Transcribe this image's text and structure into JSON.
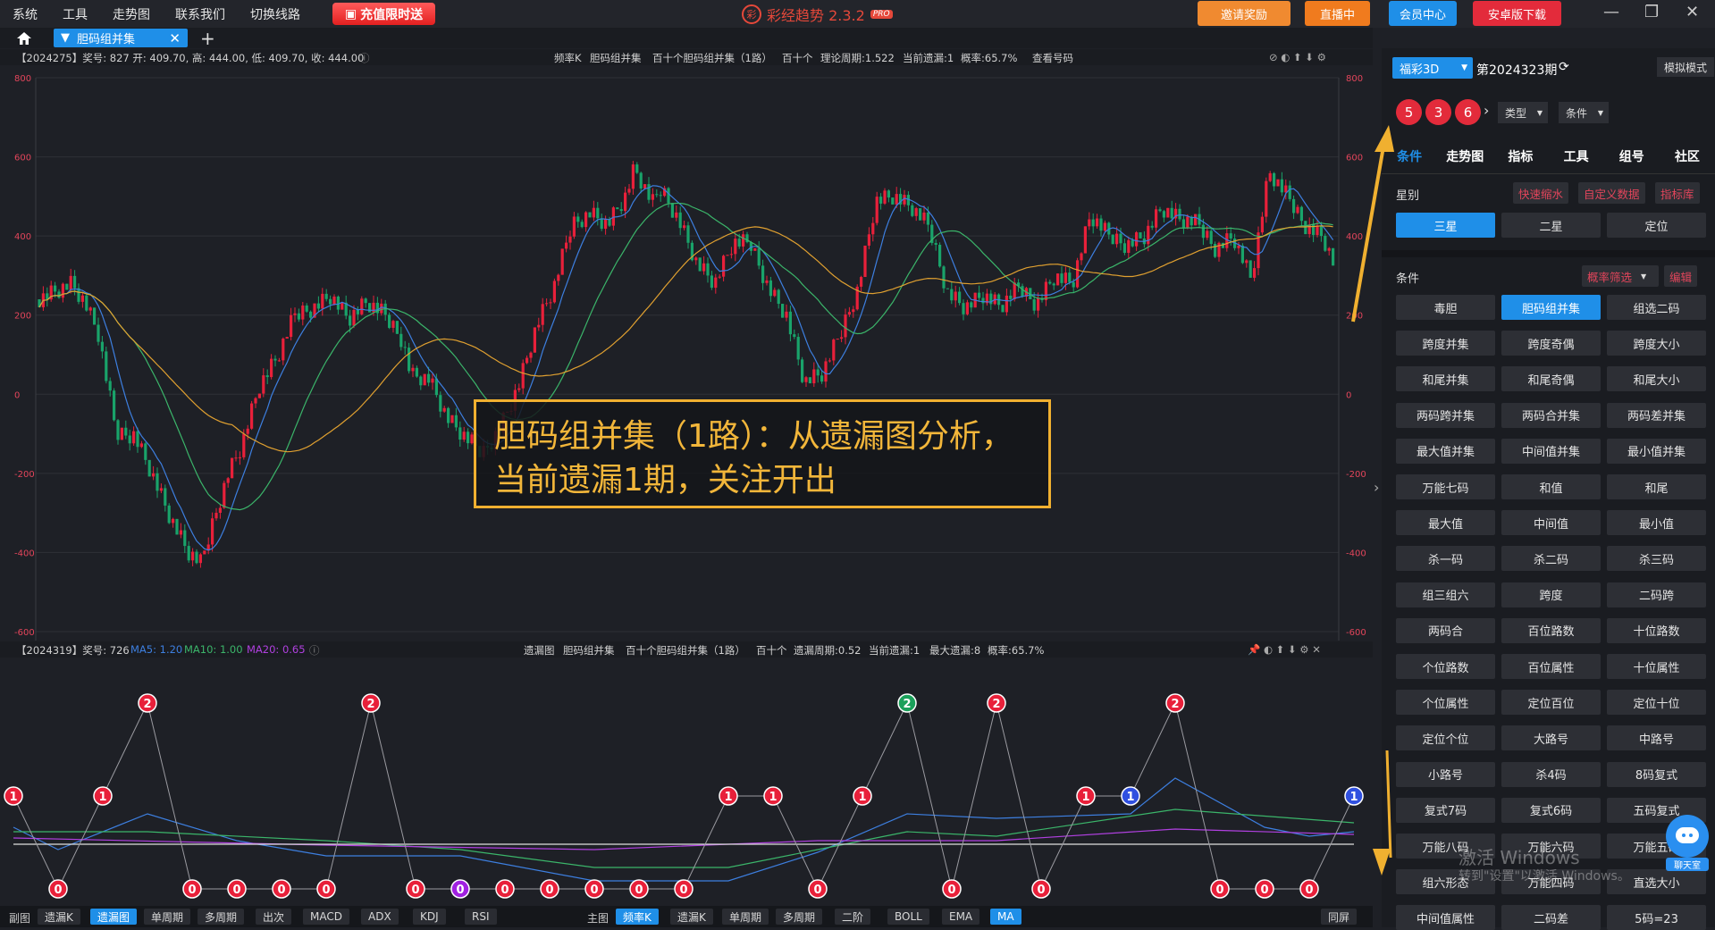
{
  "menu": [
    "系统",
    "工具",
    "走势图",
    "联系我们",
    "切换线路"
  ],
  "promo_label": "充值限时送",
  "app": {
    "name": "彩经趋势 2.3.2",
    "badge": "PRO"
  },
  "top_buttons": {
    "invite": "邀请奖励",
    "live": "直播中",
    "member": "会员中心",
    "android": "安卓版下载"
  },
  "tab": {
    "label": "胆码组并集"
  },
  "chart1": {
    "info_left": "【2024275】奖号: 827  开: 409.70, 高: 444.00, 低: 409.70, 收: 444.00",
    "info_mid": [
      "频率K",
      "胆码组并集",
      "百十个胆码组并集（1路）",
      "百十个",
      "理论周期:1.522",
      "当前遗漏:1",
      "概率:65.7%",
      "查看号码"
    ],
    "y_ticks": [
      "800",
      "600",
      "400",
      "200",
      "0",
      "-200",
      "-400",
      "-600"
    ]
  },
  "chart2": {
    "info_left_prefix": "【2024319】奖号: 726",
    "ma5": "MA5: 1.20",
    "ma10": "MA10: 1.00",
    "ma20": "MA20: 0.65",
    "info_mid": [
      "遗漏图",
      "胆码组并集",
      "百十个胆码组并集（1路）",
      "百十个",
      "遗漏周期:0.52",
      "当前遗漏:1",
      "最大遗漏:8",
      "概率:65.7%"
    ]
  },
  "annotation": {
    "line1": "胆码组并集（1路）：从遗漏图分析，",
    "line2": "当前遗漏1期，关注开出"
  },
  "bottom": {
    "left_label": "副图",
    "left_buttons": [
      "遗漏K",
      "遗漏图",
      "单周期",
      "多周期",
      "出次",
      "MACD",
      "ADX",
      "KDJ",
      "RSI"
    ],
    "mid_label": "主图",
    "mid_buttons": [
      "频率K",
      "遗漏K",
      "单周期",
      "多周期",
      "二阶",
      "BOLL",
      "EMA",
      "MA"
    ],
    "right_button": "同屏"
  },
  "panel": {
    "lottery": "福彩3D",
    "period": "第2024323期",
    "sim_mode": "模拟模式",
    "balls": [
      "5",
      "3",
      "6"
    ],
    "type_label": "类型",
    "cond_label": "条件",
    "tabs": [
      "条件",
      "走势图",
      "指标",
      "工具",
      "组号",
      "社区"
    ],
    "star_label": "星别",
    "star_links": [
      "快速缩水",
      "自定义数据",
      "指标库"
    ],
    "stars": [
      "三星",
      "二星",
      "定位"
    ],
    "cond_section": "条件",
    "prob_filter": "概率筛选",
    "edit": "编辑",
    "conditions": [
      "毒胆",
      "胆码组并集",
      "组选二码",
      "跨度并集",
      "跨度奇偶",
      "跨度大小",
      "和尾并集",
      "和尾奇偶",
      "和尾大小",
      "两码跨并集",
      "两码合并集",
      "两码差并集",
      "最大值并集",
      "中间值并集",
      "最小值并集",
      "万能七码",
      "和值",
      "和尾",
      "最大值",
      "中间值",
      "最小值",
      "杀一码",
      "杀二码",
      "杀三码",
      "组三组六",
      "跨度",
      "二码跨",
      "两码合",
      "百位路数",
      "十位路数",
      "个位路数",
      "百位属性",
      "十位属性",
      "个位属性",
      "定位百位",
      "定位十位",
      "定位个位",
      "大路号",
      "中路号",
      "小路号",
      "杀4码",
      "8码复式",
      "复式7码",
      "复式6码",
      "五码复式",
      "万能八码",
      "万能六码",
      "万能五码",
      "组六形态",
      "万能四码",
      "直选大小",
      "中间值属性",
      "二码差",
      "5码=23"
    ]
  },
  "watermark": {
    "line1": "激活 Windows",
    "line2": "转到\"设置\"以激活 Windows。"
  },
  "chat_label": "聊天室",
  "colors": {
    "up": "#e8203a",
    "down": "#19a36a",
    "accent": "#1f8fe8",
    "ma_blue": "#3d7fe0",
    "ma_green": "#3bb56a",
    "ma_orange": "#e0a030"
  }
}
